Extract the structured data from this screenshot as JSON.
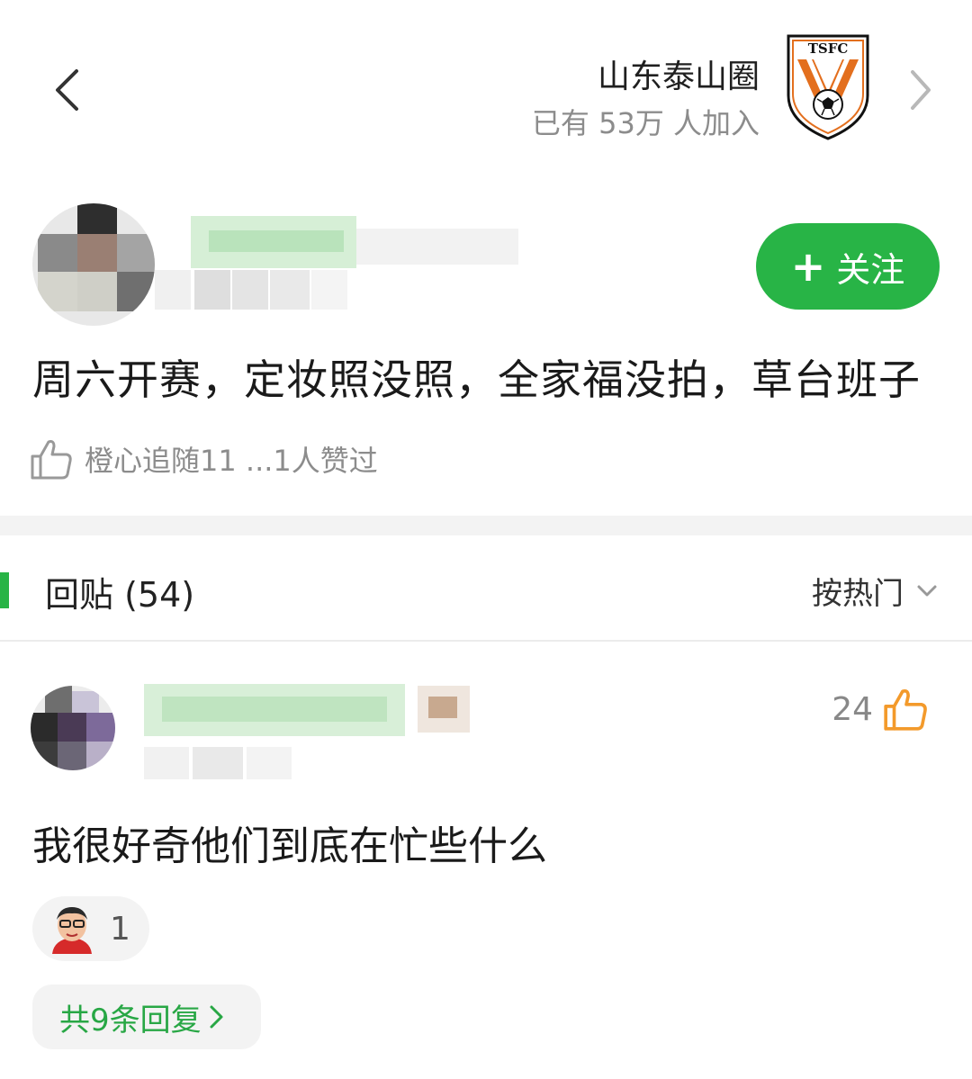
{
  "header": {
    "back_icon": "chevron-left-icon",
    "circle_name": "山东泰山圈",
    "circle_members": "已有 53万 人加入",
    "club_logo_text": "TSFC",
    "next_icon": "chevron-right-icon"
  },
  "post": {
    "follow_label": "关注",
    "follow_icon": "plus-icon",
    "text": "周六开赛，定妆照没照，全家福没拍，草台班子",
    "like_summary": "橙心追随11 ...1人赞过",
    "like_icon": "thumbs-up-outline-icon"
  },
  "replies_bar": {
    "title": "回贴 (54)",
    "sort_label": "按热门",
    "sort_icon": "chevron-down-icon"
  },
  "comment": {
    "likes": "24",
    "like_icon": "thumbs-up-orange-icon",
    "text": "我很好奇他们到底在忙些什么",
    "reaction_count": "1",
    "replies_label": "共9条回复",
    "replies_icon": "chevron-right-icon"
  },
  "colors": {
    "accent_green": "#28b446",
    "like_orange": "#f39a2b"
  }
}
